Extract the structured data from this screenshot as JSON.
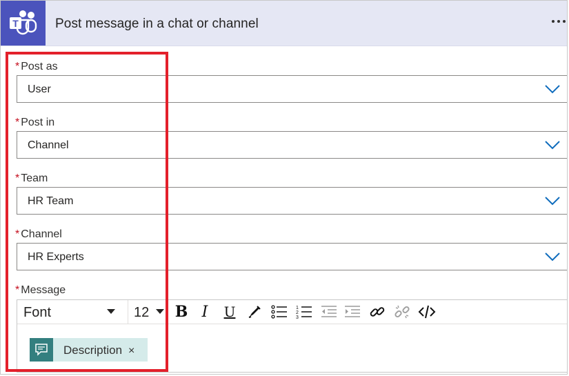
{
  "header": {
    "title": "Post message in a chat or channel",
    "icon": "teams-logo-icon",
    "more_icon": "more-options-icon"
  },
  "fields": [
    {
      "label": "Post as",
      "required_mark": "*",
      "value": "User"
    },
    {
      "label": "Post in",
      "required_mark": "*",
      "value": "Channel"
    },
    {
      "label": "Team",
      "required_mark": "*",
      "value": "HR Team"
    },
    {
      "label": "Channel",
      "required_mark": "*",
      "value": "HR Experts"
    }
  ],
  "message": {
    "label": "Message",
    "required_mark": "*",
    "toolbar": {
      "font": "Font",
      "size": "12",
      "bold": "B",
      "italic": "I",
      "underline": "U",
      "icons": [
        "pen-icon",
        "bulleted-list-icon",
        "numbered-list-icon",
        "decrease-indent-icon",
        "increase-indent-icon",
        "link-icon",
        "unlink-icon",
        "code-view-icon"
      ]
    },
    "token": {
      "label": "Description",
      "close": "×",
      "icon": "chat-bubble-icon"
    }
  },
  "colors": {
    "header_bg": "#e5e7f4",
    "teams_tile": "#4b53bc",
    "required": "#c50f1f",
    "chevron": "#0f6cbd",
    "highlight": "#e3202b",
    "token_bg": "#d5ebea",
    "token_icon_bg": "#337f7f"
  }
}
